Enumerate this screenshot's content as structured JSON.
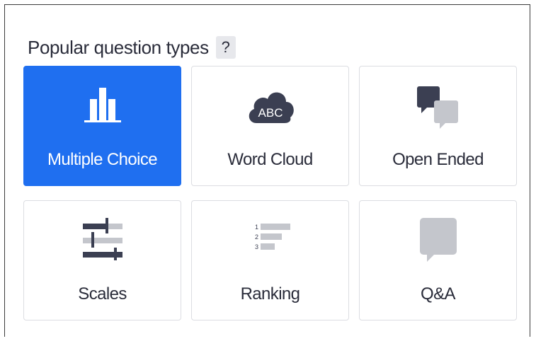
{
  "section": {
    "title": "Popular question types",
    "help_label": "?"
  },
  "question_types": [
    {
      "label": "Multiple Choice",
      "icon": "bar-chart-icon",
      "selected": true
    },
    {
      "label": "Word Cloud",
      "icon": "cloud-abc-icon",
      "icon_text": "ABC"
    },
    {
      "label": "Open Ended",
      "icon": "speech-bubbles-icon"
    },
    {
      "label": "Scales",
      "icon": "sliders-icon"
    },
    {
      "label": "Ranking",
      "icon": "ranking-list-icon",
      "rank_numbers": [
        "1",
        "2",
        "3"
      ]
    },
    {
      "label": "Q&A",
      "icon": "chat-bubble-icon"
    }
  ],
  "colors": {
    "accent": "#1f6ff0",
    "text": "#2a2c3a",
    "icon_dark": "#3b3f52",
    "icon_light": "#c4c6cc"
  }
}
